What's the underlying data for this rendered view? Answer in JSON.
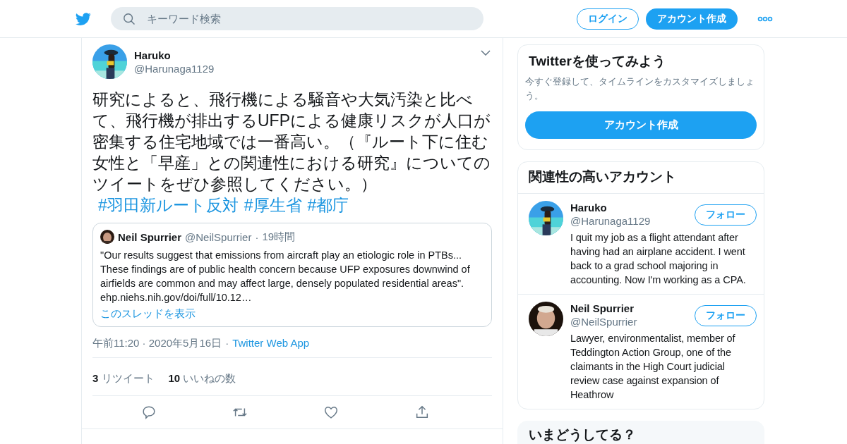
{
  "header": {
    "search": {
      "placeholder": "キーワード検索"
    },
    "login_button": "ログイン",
    "signup_button": "アカウント作成"
  },
  "tweet": {
    "author": {
      "name": "Haruko",
      "handle": "@Harunaga1129"
    },
    "text": "研究によると、飛行機による騒音や大気汚染と比べて、飛行機が排出するUFPによる健康リスクが人口が密集する住宅地域では一番高い。（『ルート下に住む女性と「早産」との関連性における研究』についてのツイートをぜひ参照してください。）",
    "hashtags": [
      "#羽田新ルート反対",
      "#厚生省",
      "#都庁"
    ],
    "quote": {
      "name": "Neil Spurrier",
      "handle": "@NeilSpurrier",
      "separator": "·",
      "time": "19時間",
      "text": "\"Our results suggest that emissions from aircraft play an etiologic role in PTBs... These findings are of public health concern because UFP exposures downwind of airfields are common and may affect large, densely populated residential areas\". ehp.niehs.nih.gov/doi/full/10.12…",
      "thread_link": "このスレッドを表示"
    },
    "timestamp": "午前11:20 · 2020年5月16日",
    "meta_separator": "·",
    "source": "Twitter Web App",
    "stats": [
      {
        "count": "3",
        "label": "リツイート"
      },
      {
        "count": "10",
        "label": "いいねの数"
      }
    ]
  },
  "sidebar": {
    "signup_card": {
      "title": "Twitterを使ってみよう",
      "text": "今すぐ登録して、タイムラインをカスタマイズしましょう。",
      "button": "アカウント作成"
    },
    "related": {
      "title": "関連性の高いアカウント",
      "accounts": [
        {
          "name": "Haruko",
          "handle": "@Harunaga1129",
          "follow": "フォロー",
          "bio": "I quit my job as a flight attendant after having had an airplane accident. I went back to a grad school majoring in accounting. Now I'm working as a CPA."
        },
        {
          "name": "Neil Spurrier",
          "handle": "@NeilSpurrier",
          "follow": "フォロー",
          "bio": "Lawyer, environmentalist, member of Teddington Action Group, one of the claimants in the High Court judicial review case against expansion of Heathrow"
        }
      ]
    },
    "trends": {
      "title": "いまどうしてる？"
    }
  }
}
